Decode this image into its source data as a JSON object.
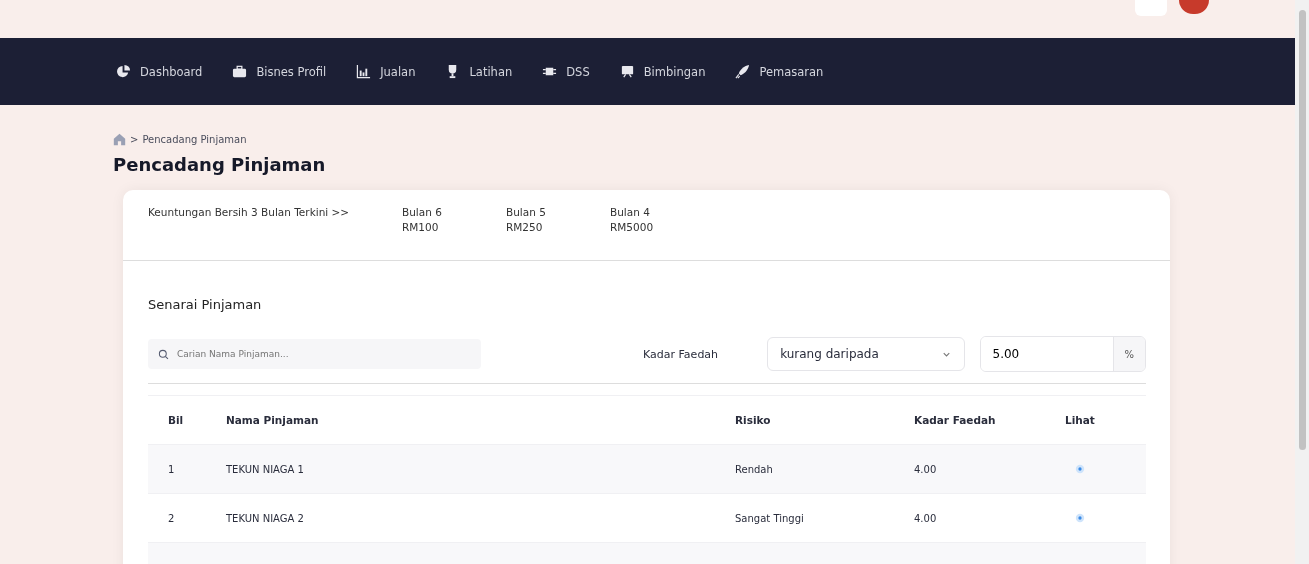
{
  "nav": [
    {
      "label": "Dashboard"
    },
    {
      "label": "Bisnes Profil"
    },
    {
      "label": "Jualan"
    },
    {
      "label": "Latihan"
    },
    {
      "label": "DSS"
    },
    {
      "label": "Bimbingan"
    },
    {
      "label": "Pemasaran"
    }
  ],
  "breadcrumb": {
    "separator": ">",
    "current": "Pencadang Pinjaman"
  },
  "title": "Pencadang Pinjaman",
  "profit": {
    "label": "Keuntungan Bersih 3 Bulan Terkini >>",
    "months": [
      {
        "month": "Bulan 6",
        "amount": "RM100"
      },
      {
        "month": "Bulan 5",
        "amount": "RM250"
      },
      {
        "month": "Bulan 4",
        "amount": "RM5000"
      }
    ]
  },
  "list_title": "Senarai Pinjaman",
  "search": {
    "placeholder": "Carian Nama Pinjaman..."
  },
  "filter": {
    "label": "Kadar Faedah",
    "comparison": "kurang daripada",
    "value": "5.00",
    "unit": "%"
  },
  "table": {
    "columns": [
      "Bil",
      "Nama Pinjaman",
      "Risiko",
      "Kadar Faedah",
      "Lihat"
    ],
    "rows": [
      {
        "no": "1",
        "name": "TEKUN NIAGA 1",
        "risk": "Rendah",
        "rate": "4.00"
      },
      {
        "no": "2",
        "name": "TEKUN NIAGA 2",
        "risk": "Sangat Tinggi",
        "rate": "4.00"
      }
    ]
  }
}
